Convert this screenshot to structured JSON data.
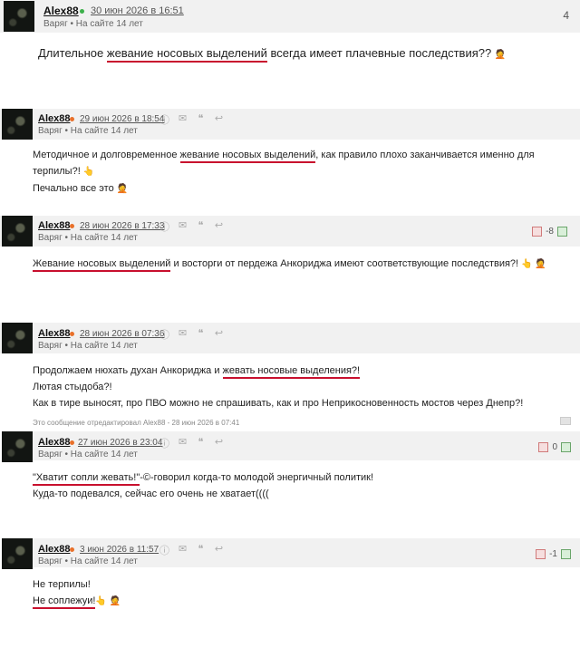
{
  "comments": [
    {
      "author": "Alex88",
      "date": "30 июн 2026 в 16:51",
      "sub": "Варяг • На сайте 14 лет",
      "count": "4",
      "lines": [
        [
          "Длительное ",
          "жевание носовых выделений",
          " всегда имеет плачевные последствия?? ",
          "🤦"
        ]
      ]
    },
    {
      "author": "Alex88",
      "date": "29 июн 2026 в 18:54",
      "sub": "Варяг • На сайте 14 лет",
      "lines": [
        [
          "Методичное и долговременное ",
          "жевание носовых выделений",
          ", как правило плохо заканчивается именно для терпилы?! ",
          "👆"
        ],
        [
          "Печально все это ",
          "",
          "",
          "🤦"
        ]
      ]
    },
    {
      "author": "Alex88",
      "date": "28 июн 2026 в 17:33",
      "sub": "Варяг • На сайте 14 лет",
      "rating": "-8",
      "lines": [
        [
          "",
          "Жевание носовых выделений",
          " и восторги от пердежа Анкориджа имеют соответствующие последствия?! ",
          "👆 🤦"
        ]
      ]
    },
    {
      "author": "Alex88",
      "date": "28 июн 2026 в 07:36",
      "sub": "Варяг • На сайте 14 лет",
      "lines": [
        [
          "Продолжаем нюхать духан Анкориджа и ",
          "жевать носовые выделения?!",
          "",
          ""
        ],
        [
          "Лютая стыдоба?!",
          "",
          "",
          ""
        ],
        [
          "Как в тире выносят, про ПВО можно не спрашивать, как и про Неприкосновенность мостов через Днепр?!",
          "",
          "",
          ""
        ]
      ],
      "edited": "Это сообщение отредактировал Alex88 - 28 июн 2026 в 07:41"
    },
    {
      "author": "Alex88",
      "date": "27 июн 2026 в 23:04",
      "sub": "Варяг • На сайте 14 лет",
      "rating": "0",
      "lines": [
        [
          "",
          "\"Хватит сопли жевать!\"",
          "-©-говорил когда-то молодой энергичный политик!",
          ""
        ],
        [
          "Куда-то подевался, сейчас его очень не хватает((((",
          "",
          "",
          ""
        ]
      ]
    },
    {
      "author": "Alex88",
      "date": "3 июн 2026 в 11:57",
      "sub": "Варяг • На сайте 14 лет",
      "rating": "-1",
      "lines": [
        [
          "Не терпилы!",
          "",
          "",
          ""
        ],
        [
          "",
          "Не соплежуи!",
          "",
          "👆 🤦"
        ]
      ]
    }
  ],
  "colors": {
    "online": "#3cb04a",
    "offline": "#e8702a",
    "underline": "#c8102e"
  }
}
